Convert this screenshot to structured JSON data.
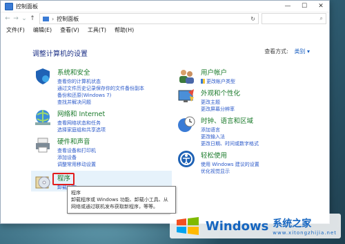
{
  "window": {
    "title": "控制面板"
  },
  "window_buttons": {
    "minimize": "—",
    "maximize": "☐",
    "close": "✕"
  },
  "nav": {
    "back": "←",
    "forward": "→",
    "down": "⌄",
    "up": "↑"
  },
  "address": {
    "separator": "›",
    "path": "控制面板",
    "refresh": "↻"
  },
  "search": {
    "placeholder": "",
    "icon": "⌕"
  },
  "menu": [
    "文件(F)",
    "编辑(E)",
    "查看(V)",
    "工具(T)",
    "帮助(H)"
  ],
  "heading": "调整计算机的设置",
  "view_by": {
    "label": "查看方式:",
    "value": "类别 ▾"
  },
  "categories_left": [
    {
      "title": "系统和安全",
      "links": [
        "查看你的计算机状态",
        "通过文件历史记录保存你的文件备份副本",
        "备份和还原(Windows 7)",
        "查找并解决问题"
      ]
    },
    {
      "title": "网络和 Internet",
      "links": [
        "查看网络状态和任务",
        "选择家庭组和共享选项"
      ]
    },
    {
      "title": "硬件和声音",
      "links": [
        "查看设备和打印机",
        "添加设备",
        "调整常用移动设置"
      ]
    },
    {
      "title": "程序",
      "links": [
        "卸载程序"
      ]
    }
  ],
  "categories_right": [
    {
      "title": "用户帐户",
      "links": [
        "更改帐户类型"
      ]
    },
    {
      "title": "外观和个性化",
      "links": [
        "更改主题",
        "更改屏幕分辨率"
      ]
    },
    {
      "title": "时钟、语言和区域",
      "links": [
        "添加语言",
        "更改输入法",
        "更改日期、时间或数字格式"
      ]
    },
    {
      "title": "轻松使用",
      "links": [
        "使用 Windows 建议的设置",
        "优化视觉显示"
      ]
    }
  ],
  "tooltip": {
    "title": "程序",
    "body": "卸载程序或 Windows 功能、卸载小工具、从网络或通过联机发布获取新程序，等等。"
  },
  "watermark": {
    "brand": "Windows",
    "cn": "系统之家",
    "url": "www.xitongzhijia.net"
  },
  "colors": {
    "title_green": "#1a7a2a",
    "link_blue": "#2a58c9",
    "heading_navy": "#1e3287",
    "highlight": "#e6f2fb",
    "red_box": "#e21b1b"
  }
}
